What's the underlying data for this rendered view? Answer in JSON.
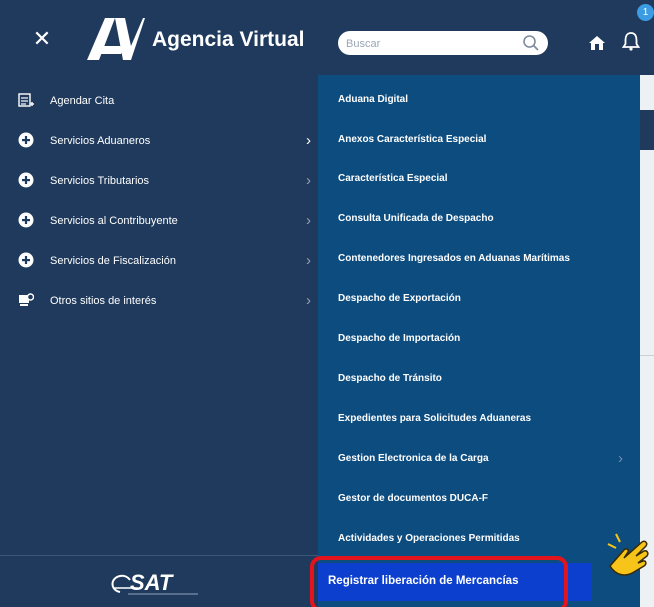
{
  "header": {
    "title": "Agencia Virtual",
    "search_placeholder": "Buscar",
    "notification_count": "1",
    "icons": [
      "close-icon",
      "logo-icon",
      "search-icon",
      "home-icon",
      "bell-icon"
    ],
    "background_color": "#1f3a5c"
  },
  "left_menu": {
    "items": [
      {
        "label": "Agendar Cita",
        "icon": "calendar-list-icon",
        "has_submenu": false
      },
      {
        "label": "Servicios Aduaneros",
        "icon": "plus-circle-icon",
        "has_submenu": true,
        "active": true
      },
      {
        "label": "Servicios Tributarios",
        "icon": "plus-circle-icon",
        "has_submenu": true
      },
      {
        "label": "Servicios al Contribuyente",
        "icon": "plus-circle-icon",
        "has_submenu": true
      },
      {
        "label": "Servicios de Fiscalización",
        "icon": "plus-circle-icon",
        "has_submenu": true
      },
      {
        "label": "Otros sitios de interés",
        "icon": "sites-icon",
        "has_submenu": true
      }
    ]
  },
  "submenu": {
    "items": [
      {
        "label": "Aduana Digital"
      },
      {
        "label": "Anexos Característica Especial"
      },
      {
        "label": "Característica Especial"
      },
      {
        "label": "Consulta Unificada de Despacho"
      },
      {
        "label": "Contenedores Ingresados en Aduanas Marítimas"
      },
      {
        "label": "Despacho de Exportación"
      },
      {
        "label": "Despacho de Importación"
      },
      {
        "label": "Despacho de Tránsito"
      },
      {
        "label": "Expedientes para Solicitudes Aduaneras"
      },
      {
        "label": "Gestion Electronica de la Carga",
        "has_submenu": true
      },
      {
        "label": "Gestor de documentos DUCA-F"
      },
      {
        "label": "Actividades y Operaciones Permitidas"
      }
    ],
    "highlighted": {
      "label": "Registrar liberación  de Mercancías"
    },
    "background_color": "#0d4c7f"
  },
  "footer": {
    "logo": "SAT"
  },
  "colors": {
    "highlight": "#0c3fce",
    "callout_border": "#e2141e"
  }
}
